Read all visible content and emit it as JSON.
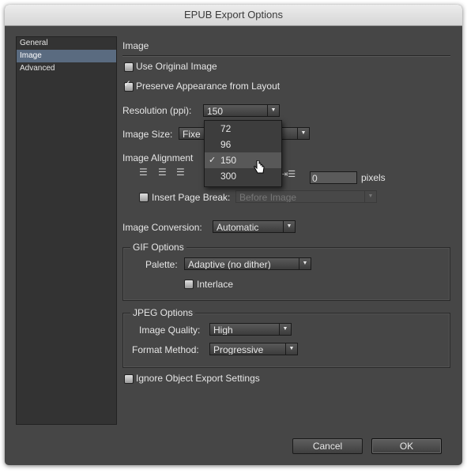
{
  "window": {
    "title": "EPUB Export Options"
  },
  "sidebar": {
    "items": [
      {
        "label": "General"
      },
      {
        "label": "Image"
      },
      {
        "label": "Advanced"
      }
    ]
  },
  "image": {
    "section_title": "Image",
    "use_original_label": "Use Original Image",
    "use_original_checked": false,
    "preserve_label": "Preserve Appearance from Layout",
    "preserve_checked": true,
    "resolution_label": "Resolution (ppi):",
    "resolution_value": "150",
    "resolution_options": [
      "72",
      "96",
      "150",
      "300"
    ],
    "image_size_label": "Image Size:",
    "image_size_value": "Fixe",
    "alignment_label": "Image Alignment",
    "spacing_value": "0",
    "spacing_unit": "pixels",
    "page_break_label": "Insert Page Break:",
    "page_break_checked": false,
    "page_break_value": "Before Image",
    "conversion_label": "Image Conversion:",
    "conversion_value": "Automatic"
  },
  "gif": {
    "title": "GIF Options",
    "palette_label": "Palette:",
    "palette_value": "Adaptive (no dither)",
    "interlace_label": "Interlace",
    "interlace_checked": false
  },
  "jpeg": {
    "title": "JPEG Options",
    "quality_label": "Image Quality:",
    "quality_value": "High",
    "format_label": "Format Method:",
    "format_value": "Progressive"
  },
  "ignore": {
    "label": "Ignore Object Export Settings",
    "checked": false
  },
  "buttons": {
    "cancel": "Cancel",
    "ok": "OK"
  }
}
